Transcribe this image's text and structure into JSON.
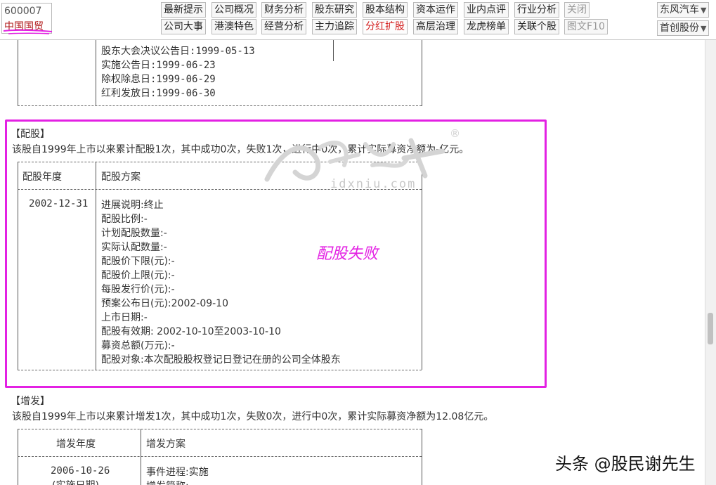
{
  "stock": {
    "code": "600007",
    "name": "中国国贸"
  },
  "nav_row1": [
    "最新提示",
    "公司概况",
    "财务分析",
    "股东研究",
    "股本结构",
    "资本运作",
    "业内点评",
    "行业分析",
    "关闭"
  ],
  "nav_row2": [
    "公司大事",
    "港澳特色",
    "经营分析",
    "主力追踪",
    "分红扩股",
    "高层治理",
    "龙虎榜单",
    "关联个股",
    "图文F10"
  ],
  "right_dropdowns": [
    {
      "label": "东风汽车",
      "arrow": "▼"
    },
    {
      "label": "首创股份",
      "arrow": "▼"
    }
  ],
  "dividend_dates": [
    "股东大会决议公告日:1999-05-13",
    "实施公告日:1999-06-23",
    "除权除息日:1999-06-29",
    "红利发放日:1999-06-30"
  ],
  "rights": {
    "heading": "【配股】",
    "summary": "该股自1999年上市以来累计配股1次，其中成功0次，失败1次，进行中0次，累计实际募资净额为-亿元。",
    "col_year": "配股年度",
    "col_plan": "配股方案",
    "year": "2002-12-31",
    "items": [
      "进展说明:终止",
      "配股比例:-",
      "计划配股数量:-",
      "实际认配数量:-",
      "配股价下限(元):-",
      "配股价上限(元):-",
      "每股发行价(元):-",
      "预案公布日(元):2002-09-10",
      "上市日期:-",
      "配股有效期: 2002-10-10至2003-10-10",
      "募资总额(万元):-",
      "配股对象:本次配股股权登记日登记在册的公司全体股东"
    ],
    "annotation": "配股失败"
  },
  "issue": {
    "heading": "【增发】",
    "summary": "该股自1999年上市以来累计增发1次，其中成功1次，失败0次，进行中0次，累计实际募资净额为12.08亿元。",
    "col_year": "增发年度",
    "col_plan": "增发方案",
    "year": "2006-10-26",
    "year_note": "(实施日期)",
    "items": [
      "事件进程:实施",
      "增发简称:"
    ]
  },
  "watermark": {
    "text": "idxniu.com",
    "mark": "®"
  },
  "credit": "头条 @股民谢先生"
}
